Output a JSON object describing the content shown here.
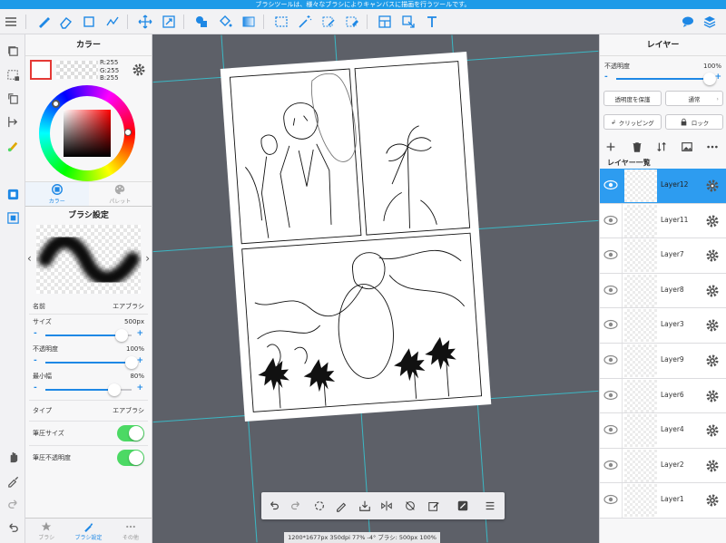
{
  "status_bar": {
    "text": "ブラシツールは、様々なブラシによりキャンバスに描画を行うツールです。"
  },
  "color_panel": {
    "title": "カラー",
    "rgb": {
      "r": "R:255",
      "g": "G:255",
      "b": "B:255"
    },
    "tabs": [
      {
        "label": "カラー",
        "icon": "color-circle-icon"
      },
      {
        "label": "パレット",
        "icon": "palette-icon"
      }
    ]
  },
  "brush_settings": {
    "title": "ブラシ設定",
    "name_label": "名前",
    "name_value": "エアブラシ",
    "size_label": "サイズ",
    "size_value": "500px",
    "size_level": 0.88,
    "opacity_label": "不透明度",
    "opacity_value": "100%",
    "opacity_level": 1.0,
    "min_width_label": "最小幅",
    "min_width_value": "80%",
    "min_width_level": 0.8,
    "type_label": "タイプ",
    "type_value": "エアブラシ",
    "pressure_size_label": "筆圧サイズ",
    "pressure_opacity_label": "筆圧不透明度",
    "bottom_tabs": [
      {
        "label": "ブラシ",
        "icon": "star-icon"
      },
      {
        "label": "ブラシ設定",
        "icon": "brush-icon"
      },
      {
        "label": "その他",
        "icon": "more-icon"
      }
    ]
  },
  "canvas": {
    "info": "1200*1677px 350dpi 77% -4° ブラシ: 500px 100%"
  },
  "layer_panel": {
    "title": "レイヤー",
    "opacity_label": "不透明度",
    "opacity_value": "100%",
    "opacity_level": 1.0,
    "protect_alpha": "透明度を保護",
    "blend_mode": "通常",
    "clipping": "クリッピング",
    "lock": "ロック",
    "list_title": "レイヤー一覧",
    "layers": [
      {
        "name": "Layer12",
        "selected": true
      },
      {
        "name": "Layer11"
      },
      {
        "name": "Layer7"
      },
      {
        "name": "Layer8"
      },
      {
        "name": "Layer3"
      },
      {
        "name": "Layer9"
      },
      {
        "name": "Layer6"
      },
      {
        "name": "Layer4"
      },
      {
        "name": "Layer2"
      },
      {
        "name": "Layer1"
      }
    ]
  },
  "colors": {
    "accent": "#1e88e5",
    "status_bar": "#1e9be8",
    "selected_layer": "#2d9cf0",
    "guide": "#3bb7c4",
    "toggle_on": "#4cd964"
  }
}
